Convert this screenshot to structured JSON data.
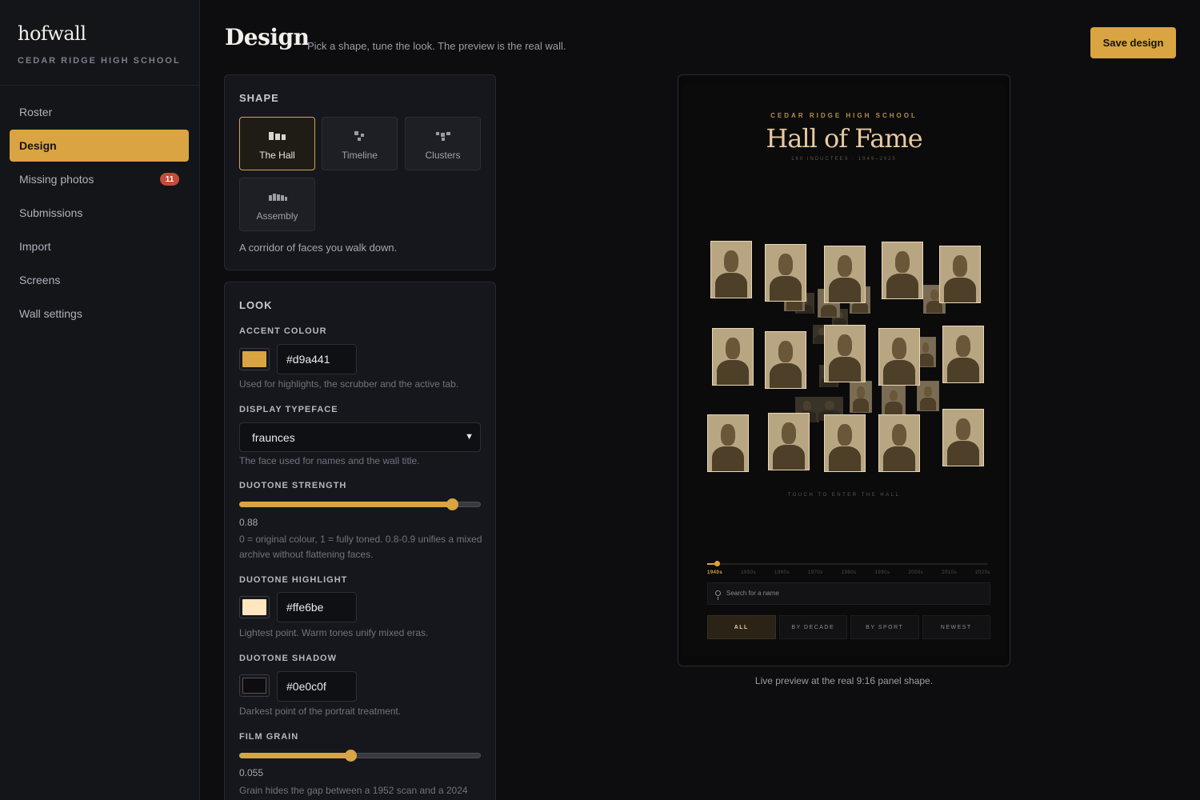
{
  "app": {
    "name": "hofwall",
    "school": "CEDAR RIDGE HIGH SCHOOL"
  },
  "nav": [
    {
      "label": "Roster"
    },
    {
      "label": "Design",
      "active": true
    },
    {
      "label": "Missing photos",
      "badge": "11"
    },
    {
      "label": "Submissions"
    },
    {
      "label": "Import"
    },
    {
      "label": "Screens"
    },
    {
      "label": "Wall settings"
    }
  ],
  "header": {
    "title": "Design",
    "subtitle": "Pick a shape, tune the look. The preview is the real wall.",
    "save_label": "Save design"
  },
  "shape": {
    "heading": "SHAPE",
    "options": [
      {
        "label": "The Hall",
        "icon": "hall-icon",
        "selected": true
      },
      {
        "label": "Timeline",
        "icon": "timeline-icon"
      },
      {
        "label": "Clusters",
        "icon": "clusters-icon"
      },
      {
        "label": "Assembly",
        "icon": "assembly-icon"
      }
    ],
    "description": "A corridor of faces you walk down."
  },
  "look": {
    "heading": "LOOK",
    "accent": {
      "label": "ACCENT COLOUR",
      "value": "#d9a441",
      "help": "Used for highlights, the scrubber and the active tab."
    },
    "typeface": {
      "label": "DISPLAY TYPEFACE",
      "value": "fraunces",
      "help": "The face used for names and the wall title."
    },
    "duotone_strength": {
      "label": "DUOTONE STRENGTH",
      "value": "0.88",
      "fraction": 0.88,
      "help": "0 = original colour, 1 = fully toned. 0.8-0.9 unifies a mixed archive without flattening faces."
    },
    "duotone_highlight": {
      "label": "DUOTONE HIGHLIGHT",
      "value": "#ffe6be",
      "help": "Lightest point. Warm tones unify mixed eras."
    },
    "duotone_shadow": {
      "label": "DUOTONE SHADOW",
      "value": "#0e0c0f",
      "help": "Darkest point of the portrait treatment."
    },
    "film_grain": {
      "label": "FILM GRAIN",
      "value": "0.055",
      "fraction": 0.46,
      "help": "Grain hides the gap between a 1952 scan and a 2024"
    }
  },
  "preview": {
    "school": "CEDAR RIDGE HIGH SCHOOL",
    "title": "Hall of Fame",
    "stats": "160 INDUCTEES · 1949–2025",
    "enter": "TOUCH TO ENTER THE HALL",
    "decades": [
      "1940s",
      "1950s",
      "1960s",
      "1970s",
      "1980s",
      "1990s",
      "2000s",
      "2010s",
      "2020s"
    ],
    "active_decade": "1940s",
    "search_placeholder": "Search for a name",
    "tabs": [
      "ALL",
      "BY DECADE",
      "BY SPORT",
      "NEWEST"
    ],
    "active_tab": "ALL",
    "caption": "Live preview at the real 9:16 panel shape."
  }
}
